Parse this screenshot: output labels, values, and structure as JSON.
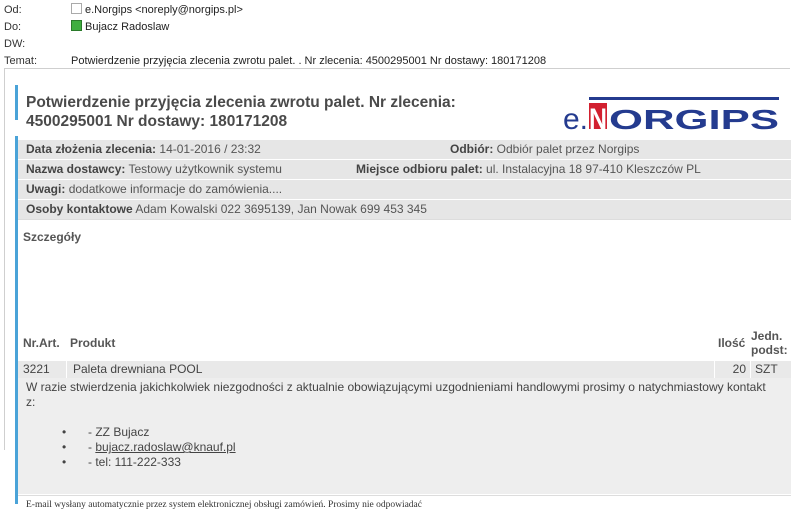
{
  "header": {
    "from_label": "Od:",
    "from_value": "e.Norgips <noreply@norgips.pl>",
    "to_label": "Do:",
    "to_value": "Bujacz Radoslaw",
    "cc_label": "DW:",
    "subject_label": "Temat:",
    "subject_value": "Potwierdzenie przyjęcia zlecenia zwrotu palet. . Nr zlecenia: 4500295001 Nr dostawy: 180171208"
  },
  "card": {
    "title": "Potwierdzenie przyjęcia zlecenia zwrotu palet. Nr zlecenia: 4500295001 Nr dostawy: 180171208",
    "logo_prefix": "e.",
    "logo_brand": "NORGIPS",
    "accent_color": "#4aa3d8",
    "logo_blue": "#243b8f",
    "logo_red": "#d2202f"
  },
  "details": {
    "order_date_label": "Data złożenia zlecenia:",
    "order_date_value": "14-01-2016 / 23:32",
    "pickup_label": "Odbiór:",
    "pickup_value": "Odbiór palet przez Norgips",
    "supplier_label": "Nazwa dostawcy:",
    "supplier_value": "Testowy użytkownik systemu",
    "place_label": "Miejsce odbioru palet:",
    "place_value": "ul. Instalacyjna 18 97-410 Kleszczów PL",
    "notes_label": "Uwagi:",
    "notes_value": "dodatkowe informacje do zamówienia....",
    "contacts_label": "Osoby kontaktowe",
    "contacts_value": "Adam Kowalski 022 3695139, Jan Nowak 699 453 345"
  },
  "section_title": "Szczegóły",
  "table": {
    "col_nr": "Nr.Art.",
    "col_product": "Produkt",
    "col_qty": "Ilość",
    "col_unit_line1": "Jedn.",
    "col_unit_line2": "podst:",
    "rows": [
      {
        "nr": "3221",
        "product": "Paleta drewniana POOL",
        "qty": "20",
        "unit": "SZT"
      }
    ]
  },
  "note": {
    "text": "W razie stwierdzenia jakichkolwiek niezgodności z aktualnie obowiązującymi uzgodnieniami handlowymi prosimy o natychmiastowy kontakt z:",
    "bullet": "•",
    "item1": "- ZZ Bujacz",
    "item2_prefix": "- ",
    "item2_link": "bujacz.radoslaw@knauf.pl",
    "item3": "- tel: 111-222-333"
  },
  "footer": "E-mail wysłany automatycznie przez system elektronicznej obsługi zamówień. Prosimy nie odpowiadać"
}
